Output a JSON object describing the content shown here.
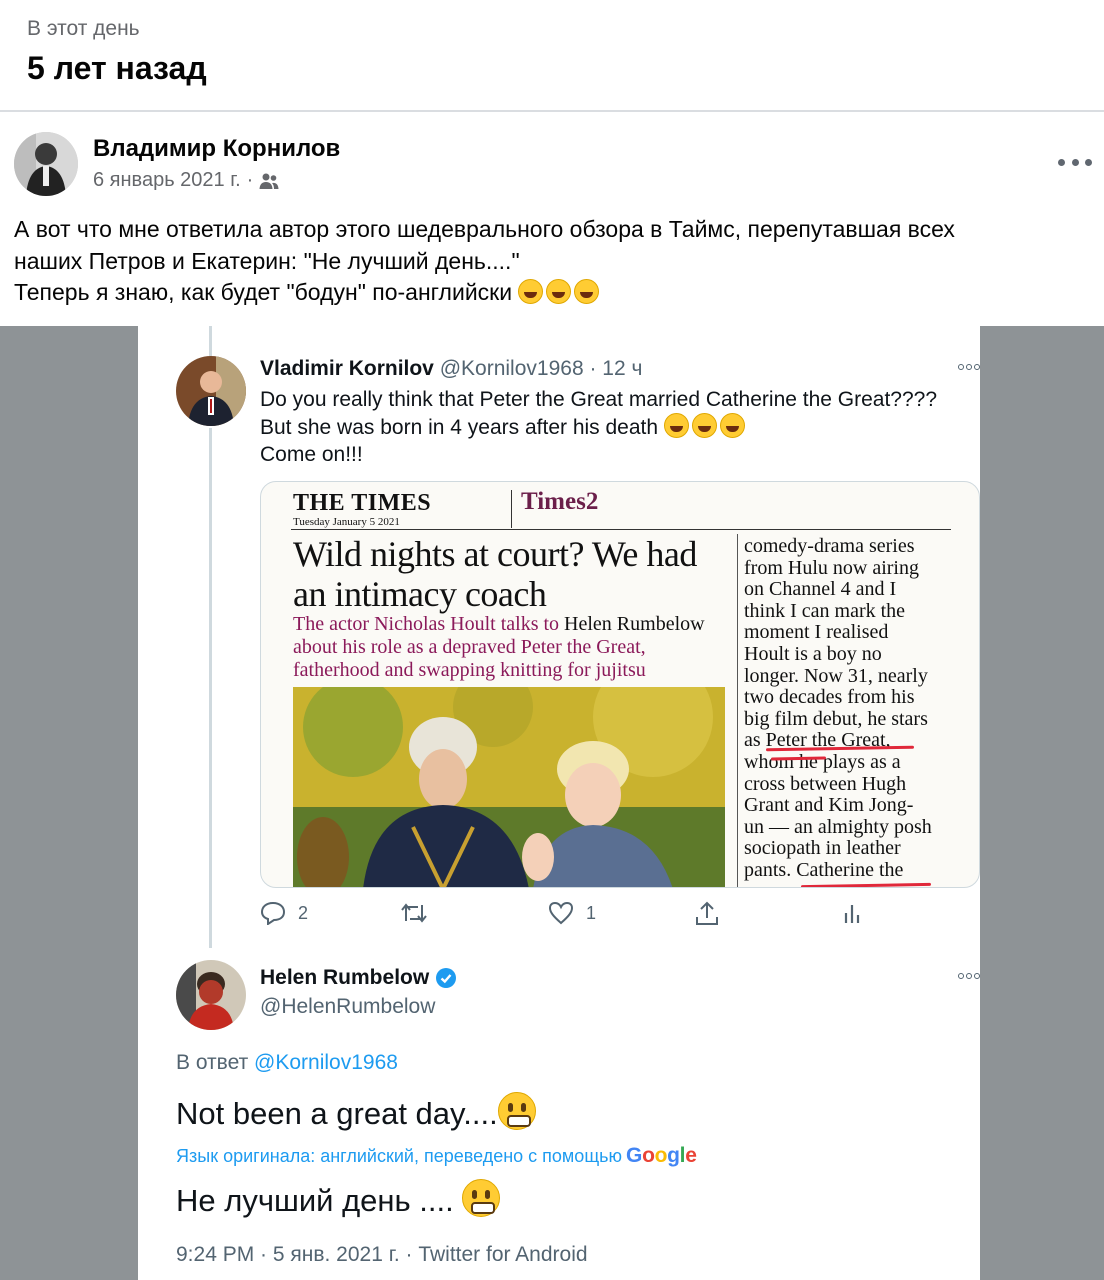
{
  "memory": {
    "kicker": "В этот день",
    "title": "5 лет назад"
  },
  "post": {
    "author": "Владимир Корнилов",
    "date": "6 январь 2021 г.",
    "separator": "·",
    "audience_icon": "people-icon",
    "text_lines": [
      "А вот что мне ответила автор этого шедеврального обзора в Таймс, перепутавшая всех",
      "наших Петров и Екатерин: \"Не лучший день....\"",
      "Теперь я знаю, как будет \"бодун\" по-английски"
    ],
    "emoji": "😂😂😂"
  },
  "tweet1": {
    "name": "Vladimir Kornilov",
    "handle": "@Kornilov1968",
    "time": "· 12 ч",
    "lines": [
      "Do you really think that Peter the Great married Catherine the Great????",
      "But she was born in 4 years after his death",
      "Come on!!!"
    ],
    "newspaper": {
      "masthead": "THE TIMES",
      "date": "Tuesday January 5 2021",
      "section": "Times2",
      "headline": "Wild nights at court? We had an intimacy coach",
      "standfirst_a": "The actor Nicholas Hoult talks to ",
      "standfirst_b": "Helen Rumbelow",
      "standfirst_c": " about his role as a depraved Peter the Great, fatherhood and swapping knitting for jujitsu",
      "column_lines": [
        "comedy-drama series",
        "from Hulu now airing",
        "on Channel 4 and I",
        "think I can mark the",
        "moment I realised",
        "Hoult is a boy no",
        "longer. Now 31, nearly",
        "two decades from his",
        "big film debut, he stars",
        "as Peter the Great,",
        "whom he plays as a",
        "cross between Hugh",
        "Grant and Kim Jong-",
        "un — an almighty posh",
        "sociopath in leather",
        "pants. Catherine the"
      ]
    },
    "replies": "2",
    "likes": "1"
  },
  "tweet2": {
    "name": "Helen Rumbelow",
    "handle": "@HelenRumbelow",
    "reply_prefix": "В ответ ",
    "reply_handle": "@Kornilov1968",
    "text": "Not been a great day....",
    "translate_note": "Язык оригинала: английский, переведено с помощью",
    "translate_brand": "Google",
    "translated": "Не лучший день ....",
    "meta": "9:24 PM · 5 янв. 2021 г. · Twitter for Android"
  },
  "colors": {
    "facebook_secondary": "#65676b",
    "twitter_blue": "#1d9bf0",
    "times_purple": "#8b1a5a",
    "highlight_red": "#e0283a"
  }
}
